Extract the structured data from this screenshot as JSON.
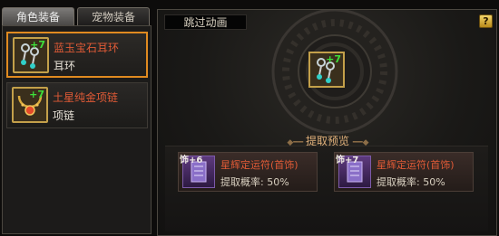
{
  "left": {
    "tabs": [
      {
        "label": "角色装备",
        "active": true
      },
      {
        "label": "宠物装备",
        "active": false
      }
    ],
    "items": [
      {
        "name": "蓝玉宝石耳环",
        "type": "耳环",
        "plus": "+7",
        "selected": true,
        "icon": "earring-icon"
      },
      {
        "name": "土星纯金项链",
        "type": "项链",
        "plus": "+7",
        "selected": false,
        "icon": "necklace-icon"
      }
    ]
  },
  "right": {
    "skip_label": "跳过动画",
    "help_label": "?",
    "center_plus": "+7",
    "preview_title": "提取预览",
    "cards": [
      {
        "tag": "饰+6",
        "name": "星辉定运符(首饰)",
        "rate": "提取概率: 50%"
      },
      {
        "tag": "饰+7",
        "name": "星辉定运符(首饰)",
        "rate": "提取概率: 50%"
      }
    ]
  },
  "colors": {
    "accent_orange": "#e08a20",
    "name_red": "#e05a36",
    "plus_green": "#3ee03a",
    "title_gold": "#e0b07a"
  }
}
